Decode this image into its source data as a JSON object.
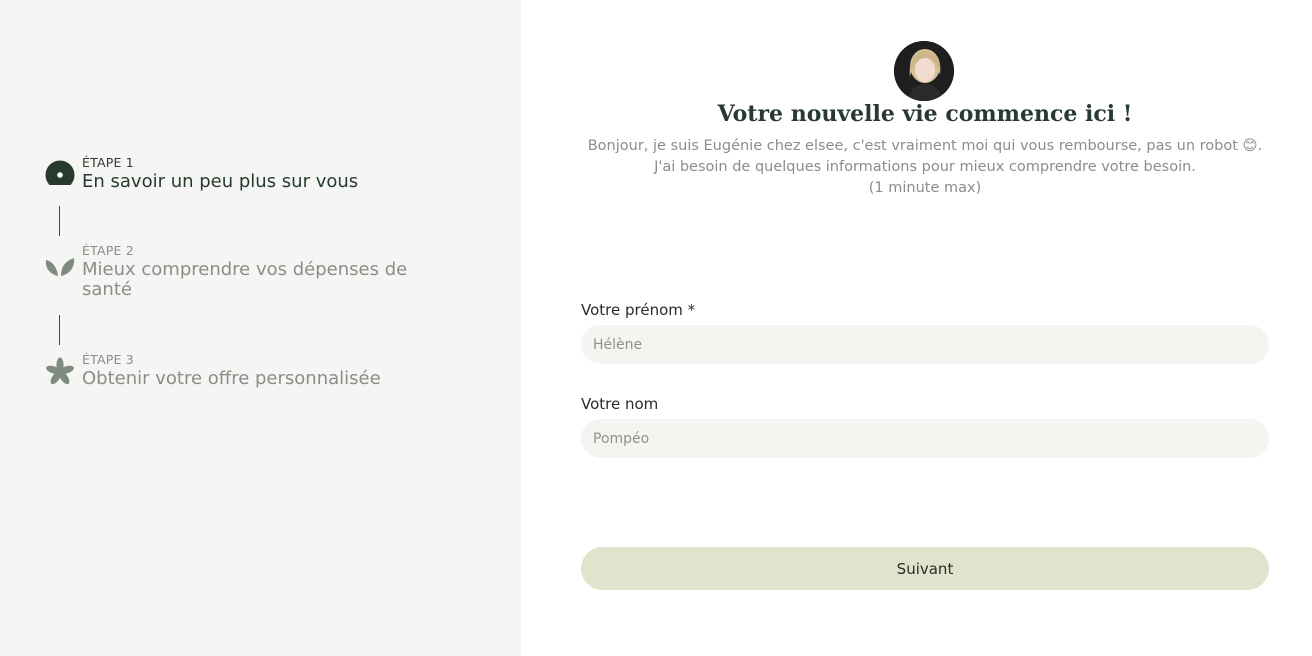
{
  "steps": [
    {
      "label": "ÉTAPE 1",
      "title": "En savoir un peu plus sur vous",
      "state": "active",
      "icon": "circle-dot-icon"
    },
    {
      "label": "ÉTAPE 2",
      "title": "Mieux comprendre vos dépenses de santé",
      "state": "upcoming",
      "icon": "leaf-icon"
    },
    {
      "label": "ÉTAPE 3",
      "title": "Obtenir votre offre personnalisée",
      "state": "upcoming",
      "icon": "flower-icon"
    }
  ],
  "header": {
    "title": "Votre nouvelle vie commence ici !",
    "intro_line1": "Bonjour, je suis Eugénie chez elsee, c'est vraiment moi qui vous rembourse, pas un robot 😊.",
    "intro_line2": "J'ai besoin de quelques informations pour mieux comprendre votre besoin.",
    "intro_line3": "(1 minute max)"
  },
  "form": {
    "first_name_label": "Votre prénom *",
    "first_name_placeholder": "Hélène",
    "last_name_label": "Votre nom",
    "last_name_placeholder": "Pompéo",
    "next_label": "Suivant"
  },
  "colors": {
    "left_bg": "#f5f6f3",
    "active_icon": "#283a30",
    "inactive_icon": "#7f8a80",
    "button_bg": "#dfe4cc",
    "input_bg": "#f4f4f0"
  }
}
